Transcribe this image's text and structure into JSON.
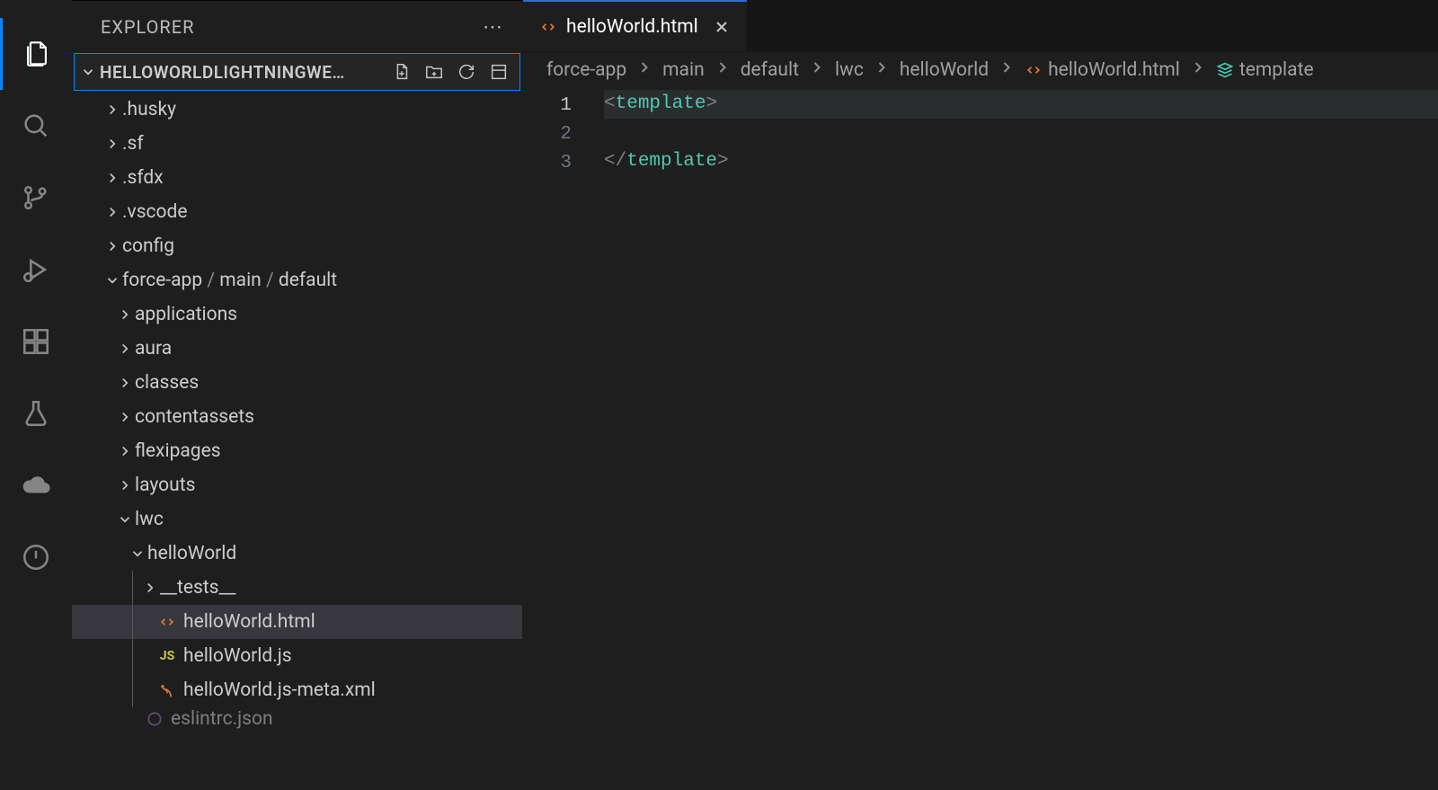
{
  "sidebar": {
    "title": "EXPLORER",
    "projectName": "HELLOWORLDLIGHTNINGWE…",
    "tree": [
      {
        "label": ".husky",
        "depth": 1,
        "kind": "folder",
        "open": false
      },
      {
        "label": ".sf",
        "depth": 1,
        "kind": "folder",
        "open": false
      },
      {
        "label": ".sfdx",
        "depth": 1,
        "kind": "folder",
        "open": false
      },
      {
        "label": ".vscode",
        "depth": 1,
        "kind": "folder",
        "open": false
      },
      {
        "label": "config",
        "depth": 1,
        "kind": "folder",
        "open": false
      },
      {
        "label": "force-app / main / default",
        "depth": 1,
        "kind": "folder",
        "open": true,
        "compound": true,
        "parts": [
          "force-app",
          "main",
          "default"
        ]
      },
      {
        "label": "applications",
        "depth": 2,
        "kind": "folder",
        "open": false
      },
      {
        "label": "aura",
        "depth": 2,
        "kind": "folder",
        "open": false
      },
      {
        "label": "classes",
        "depth": 2,
        "kind": "folder",
        "open": false
      },
      {
        "label": "contentassets",
        "depth": 2,
        "kind": "folder",
        "open": false
      },
      {
        "label": "flexipages",
        "depth": 2,
        "kind": "folder",
        "open": false
      },
      {
        "label": "layouts",
        "depth": 2,
        "kind": "folder",
        "open": false
      },
      {
        "label": "lwc",
        "depth": 2,
        "kind": "folder",
        "open": true
      },
      {
        "label": "helloWorld",
        "depth": 3,
        "kind": "folder",
        "open": true
      },
      {
        "label": "__tests__",
        "depth": 4,
        "kind": "folder",
        "open": false
      },
      {
        "label": "helloWorld.html",
        "depth": 4,
        "kind": "file",
        "icon": "html",
        "selected": true
      },
      {
        "label": "helloWorld.js",
        "depth": 4,
        "kind": "file",
        "icon": "js"
      },
      {
        "label": "helloWorld.js-meta.xml",
        "depth": 4,
        "kind": "file",
        "icon": "xml"
      },
      {
        "label": "eslintrc.json",
        "depth": 3,
        "kind": "file",
        "icon": "json",
        "cut": true
      }
    ]
  },
  "tab": {
    "filename": "helloWorld.html"
  },
  "breadcrumbs": [
    {
      "label": "force-app"
    },
    {
      "label": "main"
    },
    {
      "label": "default"
    },
    {
      "label": "lwc"
    },
    {
      "label": "helloWorld"
    },
    {
      "label": "helloWorld.html",
      "icon": "html"
    },
    {
      "label": "template",
      "icon": "symbol"
    }
  ],
  "code": {
    "lines": [
      {
        "n": 1,
        "tokens": [
          [
            "<",
            "bracket"
          ],
          [
            "template",
            "tag"
          ],
          [
            ">",
            "bracket"
          ]
        ],
        "current": true
      },
      {
        "n": 2,
        "tokens": []
      },
      {
        "n": 3,
        "tokens": [
          [
            "</",
            "bracket"
          ],
          [
            "template",
            "tag"
          ],
          [
            ">",
            "bracket"
          ]
        ]
      }
    ]
  }
}
